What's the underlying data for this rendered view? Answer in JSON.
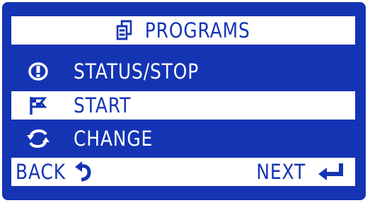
{
  "header": {
    "title": "PROGRAMS",
    "icon": "programs-stack-icon"
  },
  "menu": {
    "items": [
      {
        "label": "STATUS/STOP",
        "icon": "exclamation-circle-icon",
        "selected": false
      },
      {
        "label": "START",
        "icon": "flag-icon",
        "selected": true
      },
      {
        "label": "CHANGE",
        "icon": "change-arrows-icon",
        "selected": false
      }
    ]
  },
  "footer": {
    "back_label": "BACK",
    "back_icon": "back-arrow-icon",
    "next_label": "NEXT",
    "next_icon": "enter-arrow-icon"
  },
  "colors": {
    "background": "#1434b4",
    "highlight": "#ffffff"
  }
}
